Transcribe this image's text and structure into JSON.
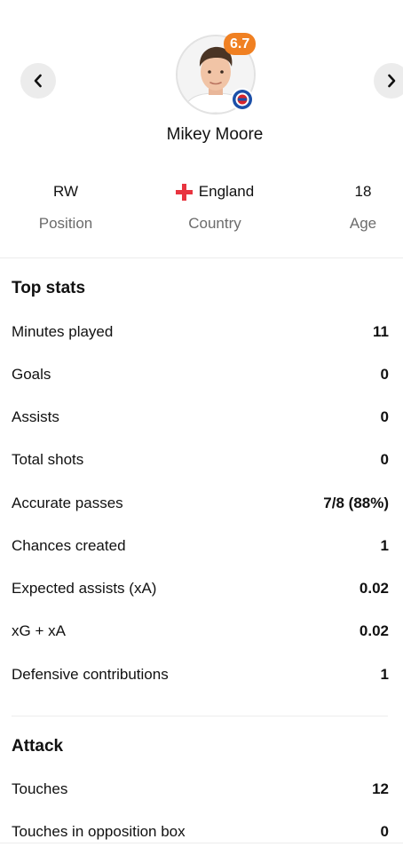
{
  "player": {
    "name": "Mikey Moore",
    "rating": "6.7",
    "avatar_icon": "player-photo",
    "club_icon": "rangers-crest-icon"
  },
  "nav": {
    "prev_icon": "chevron-left-icon",
    "next_icon": "chevron-right-icon"
  },
  "info": {
    "position_value": "RW",
    "position_label": "Position",
    "country_value": "England",
    "country_label": "Country",
    "country_flag_icon": "england-flag-icon",
    "age_value": "18",
    "age_label": "Age"
  },
  "top_stats": {
    "title": "Top stats",
    "rows": [
      {
        "label": "Minutes played",
        "value": "11"
      },
      {
        "label": "Goals",
        "value": "0"
      },
      {
        "label": "Assists",
        "value": "0"
      },
      {
        "label": "Total shots",
        "value": "0"
      },
      {
        "label": "Accurate passes",
        "value": "7/8 (88%)"
      },
      {
        "label": "Chances created",
        "value": "1"
      },
      {
        "label": "Expected assists (xA)",
        "value": "0.02"
      },
      {
        "label": "xG + xA",
        "value": "0.02"
      },
      {
        "label": "Defensive contributions",
        "value": "1"
      }
    ]
  },
  "attack": {
    "title": "Attack",
    "rows": [
      {
        "label": "Touches",
        "value": "12"
      },
      {
        "label": "Touches in opposition box",
        "value": "0"
      }
    ]
  },
  "colors": {
    "rating_badge": "#f08022",
    "secondary_text": "#6b6b6b",
    "nav_button_bg": "#ececec",
    "flag_cross": "#e8343f"
  }
}
